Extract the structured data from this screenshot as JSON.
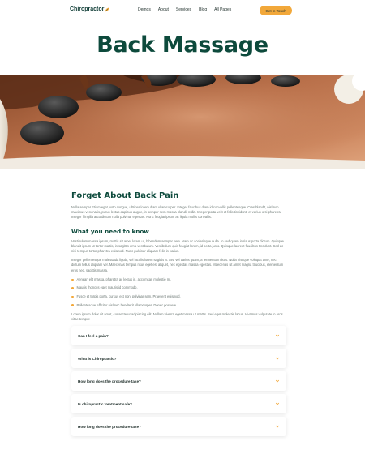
{
  "header": {
    "logo": "Chiropractor",
    "nav": [
      "Demos",
      "About",
      "Services",
      "Blog",
      "All Pages"
    ],
    "cta": "Get in Touch"
  },
  "hero": {
    "title": "Back Massage"
  },
  "article": {
    "heading": "Forget About Back Pain",
    "intro": "Nulla semper Etiam eget justo congue, ultrices lorem diam ullamcorper. Integer faucibus diam id convallis pellentesque. Cras blandit, nisl non maximus venenatis, purus lectus dapibus augue, in semper sem massa blandit nulla. Integer porta velit et felis tincidunt, et varius orci pharetra. Integer fringilla arcu dictum nulla pulvinar egestas. Nunc feugiat ipsum ac ligula mollis convallis.",
    "subheading": "What you need to know",
    "para1": "Vestibulum massa ipsum, mattis sit amet lorem ut, bibendum semper sem. Nam ac scelerisque nulla. In sed quam in risus porta dictum. Quisque blandit ipsum ut tortor mattis, in sagittis urna vestibulum. Vestibulum quis feugiat lorem, id porta justo. Quisque laoreet faucibus tincidunt. Sed ac nisi tempus tortor pharetra euismod. Nunc pulvinar aliquam felis in varius.",
    "para2": "Integer pellentesque malesuada ligula, vel iaculis lorem sagittis a. Sed vel varius quam, a fermentum risus. Nulla tristique volutpat ante, nec dictum tellus aliquam vel. Maecenas tempus risus eget est aliquet, nec egestas massa egestas. Maecenas sit amet magna faucibus, elementum eros nec, sagittis massa.",
    "bullets": [
      "Aenean elit massa, pharetra ac lectus in, accumsan molestie mi.",
      "Mauris rhoncus eget mauris id commodo.",
      "Fusce et turpis porta, cursus est non, pulvinar sem. Praesent euismod.",
      "Pellentesque efficitur nisl nec hendrerit ullamcorper. Donec posuere."
    ],
    "outro": "Lorem ipsum dolor sit amet, consectetur adipiscing elit. Nullam viverra eget massa ut mattis. Sed eget molestie lacus. Vivamus vulputate in eros vitae tempor."
  },
  "faq": [
    "Can I feel a pain?",
    "What is Chiropractic?",
    "How long does the procedure take?",
    "Is chiropractic treatment safe?",
    "How long does the procedure take?"
  ],
  "colors": {
    "brand_green": "#0d4a3c",
    "accent_orange": "#f2a83a"
  }
}
